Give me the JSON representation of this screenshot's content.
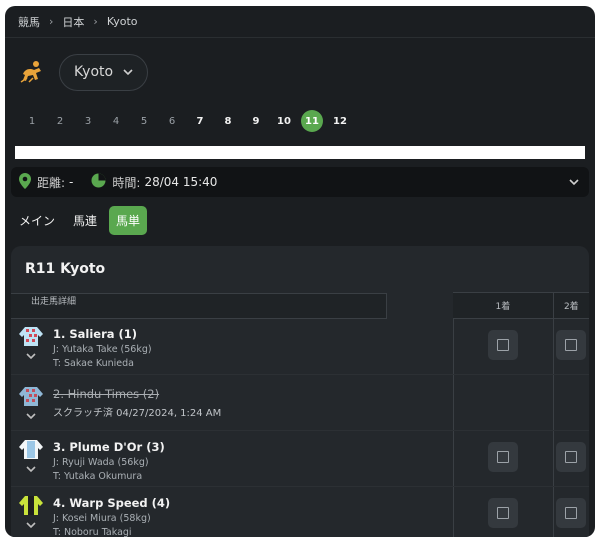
{
  "breadcrumb": {
    "sport": "競馬",
    "country": "日本",
    "venue": "Kyoto"
  },
  "venue_selector": {
    "label": "Kyoto"
  },
  "race_numbers": [
    {
      "num": "1",
      "state": "past"
    },
    {
      "num": "2",
      "state": "past"
    },
    {
      "num": "3",
      "state": "past"
    },
    {
      "num": "4",
      "state": "past"
    },
    {
      "num": "5",
      "state": "past"
    },
    {
      "num": "6",
      "state": "past"
    },
    {
      "num": "7",
      "state": "upcoming"
    },
    {
      "num": "8",
      "state": "upcoming"
    },
    {
      "num": "9",
      "state": "upcoming"
    },
    {
      "num": "10",
      "state": "upcoming"
    },
    {
      "num": "11",
      "state": "active"
    },
    {
      "num": "12",
      "state": "upcoming"
    }
  ],
  "info": {
    "distance_label": "距離:",
    "distance_value": "-",
    "time_label": "時間:",
    "time_value": "28/04 15:40"
  },
  "tabs": [
    {
      "label": "メイン",
      "active": false
    },
    {
      "label": "馬連",
      "active": false
    },
    {
      "label": "馬単",
      "active": true
    }
  ],
  "race_title": "R11 Kyoto",
  "table": {
    "col_runner": "出走馬詳細",
    "col_first": "1着",
    "col_second": "2着"
  },
  "runners": [
    {
      "name": "1. Saliera (1)",
      "jockey": "J: Yutaka Take (56kg)",
      "trainer": "T: Sakae Kunieda",
      "scratched": false
    },
    {
      "name": "2. Hindu Times (2)",
      "note": "スクラッチ済 04/27/2024, 1:24 AM",
      "scratched": true
    },
    {
      "name": "3. Plume D'Or (3)",
      "jockey": "J: Ryuji Wada (56kg)",
      "trainer": "T: Yutaka Okumura",
      "scratched": false
    },
    {
      "name": "4. Warp Speed (4)",
      "jockey": "J: Kosei Miura (58kg)",
      "trainer": "T: Noboru Takagi",
      "scratched": false
    }
  ],
  "colors": {
    "accent": "#5aa84f",
    "background": "#1b1e21",
    "panel": "#24282c",
    "venue_icon": "#e8a33a"
  },
  "icons": {
    "venue": "horse-racing-icon",
    "dropdown": "chevron-down-icon",
    "distance": "map-pin-icon",
    "time": "clock-icon",
    "expand": "chevron-down-icon",
    "select": "checkbox-icon"
  }
}
